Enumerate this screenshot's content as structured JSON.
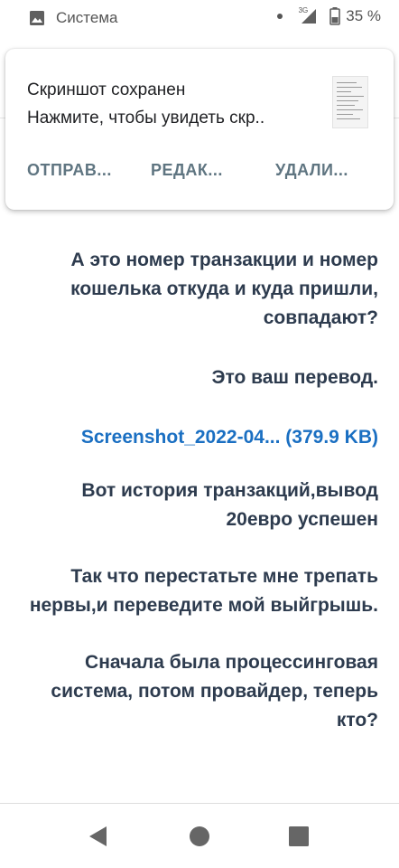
{
  "status_bar": {
    "app_name": "Система",
    "network_type": "3G",
    "battery": "35 %"
  },
  "notification": {
    "title": "Скриншот сохранен",
    "text": "Нажмите, чтобы увидеть скр..",
    "actions": [
      "ОТПРАВ...",
      "РЕДАК...",
      "УДАЛИ..."
    ]
  },
  "messages": [
    "А это номер транзакции и номер кошелька откуда и куда пришли, совпадают?",
    "Это ваш перевод.",
    "Screenshot_2022-04... (379.9 KB)",
    "Вот история транзакций,вывод 20евро успешен",
    "Так что перестатьте мне трепать нервы,и переведите мой выйгрышь.",
    "Сначала была процессинговая система, потом провайдер, теперь кто?"
  ],
  "colors": {
    "message_text": "#2d3b4e",
    "link": "#1a6fc2",
    "action_text": "#5f7581"
  },
  "icons": {
    "status": [
      "gallery-icon",
      "signal-icon",
      "battery-icon"
    ],
    "nav": [
      "back-icon",
      "home-icon",
      "recents-icon"
    ]
  }
}
